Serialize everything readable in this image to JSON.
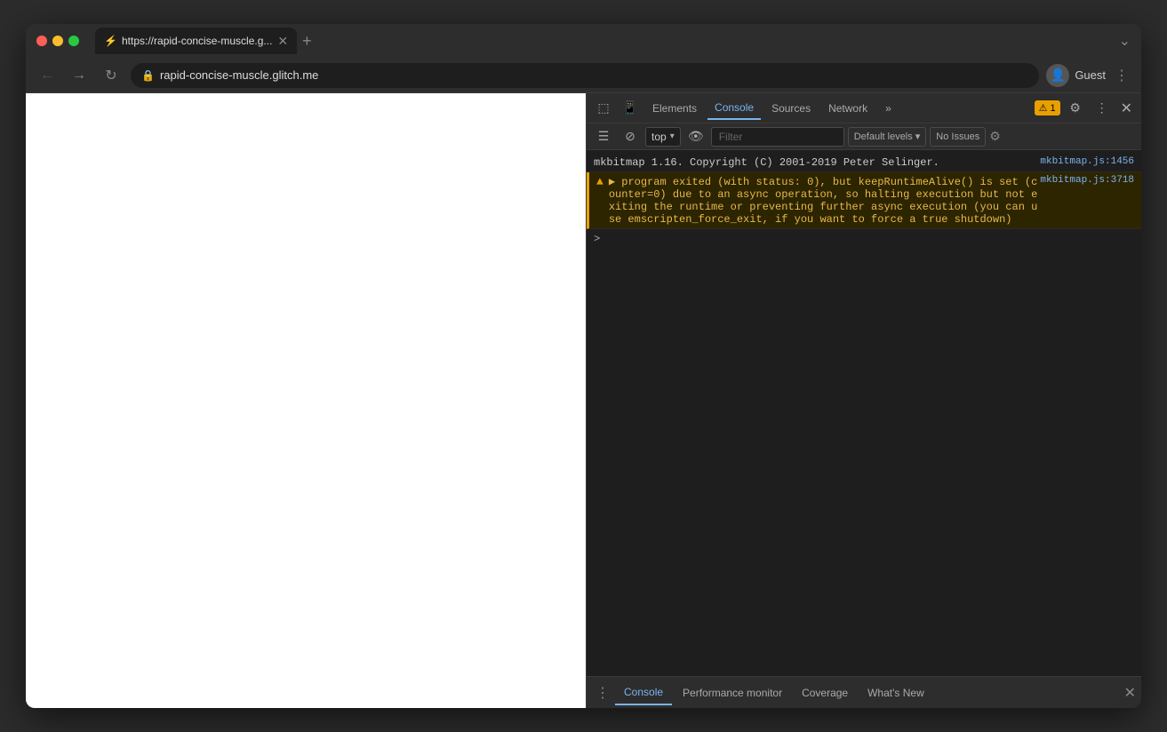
{
  "browser": {
    "tab_title": "https://rapid-concise-muscle.g...",
    "tab_favicon": "⚡",
    "url": "rapid-concise-muscle.glitch.me",
    "profile_name": "Guest"
  },
  "devtools": {
    "tabs": [
      "Elements",
      "Console",
      "Sources",
      "Network"
    ],
    "active_tab": "Console",
    "more_tabs_label": "»",
    "warning_badge": "⚠ 1",
    "close_label": "✕",
    "console_toolbar": {
      "top_label": "top",
      "filter_placeholder": "Filter",
      "levels_label": "Default levels",
      "no_issues_label": "No Issues"
    },
    "console_lines": [
      {
        "type": "info",
        "content": "mkbitmap 1.16. Copyright (C) 2001-2019 Peter Selinger.",
        "link": "mkbitmap.js:1456"
      },
      {
        "type": "warning",
        "content": "▶ program exited (with status: 0), but keepRuntimeAlive() is   set (counter=0) due to an async operation, so halting execution but not exiting the runtime or preventing further async execution (you can use emscripten_force_exit, if you want to force a true shutdown)",
        "link": "mkbitmap.js:3718"
      }
    ],
    "prompt_caret": ">"
  },
  "bottom_drawer": {
    "tabs": [
      "Console",
      "Performance monitor",
      "Coverage",
      "What's New"
    ],
    "active_tab": "Console"
  },
  "icons": {
    "back": "←",
    "forward": "→",
    "reload": "↻",
    "lock": "🔒",
    "chevron_down": "▾",
    "eye": "👁",
    "settings": "⚙",
    "more": "⋮",
    "inspect": "⬚",
    "device": "📱",
    "ban": "⊘",
    "gear": "⚙",
    "expand": "⛶"
  }
}
